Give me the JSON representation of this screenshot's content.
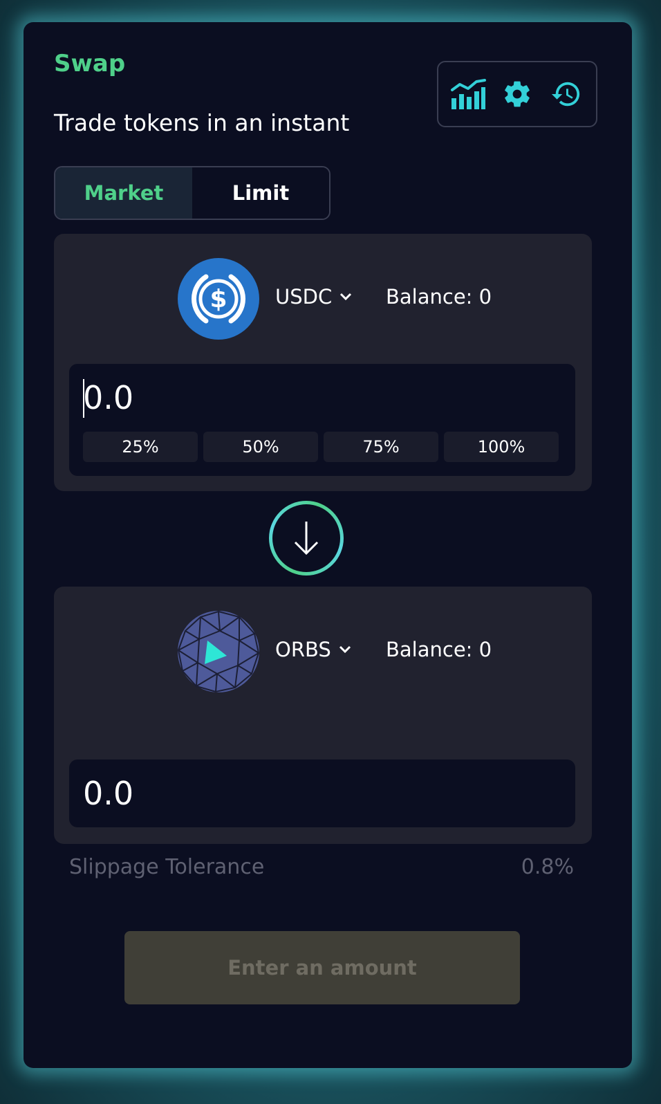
{
  "header": {
    "title": "Swap",
    "subtitle": "Trade tokens in an instant"
  },
  "toolbar": {
    "icons": [
      "chart-icon",
      "gear-icon",
      "history-icon"
    ],
    "accent_color": "#33d0d8"
  },
  "tabs": [
    {
      "label": "Market",
      "active": true
    },
    {
      "label": "Limit",
      "active": false
    }
  ],
  "from": {
    "token": "USDC",
    "balance": "Balance: 0",
    "amount_placeholder": "0.0",
    "percent_buttons": [
      "25%",
      "50%",
      "75%",
      "100%"
    ]
  },
  "to": {
    "token": "ORBS",
    "balance": "Balance: 0",
    "amount_placeholder": "0.0"
  },
  "slippage": {
    "label": "Slippage Tolerance",
    "value": "0.8%"
  },
  "cta": {
    "label": "Enter an amount"
  },
  "colors": {
    "brand_green": "#4fd08a",
    "card_bg": "#0b0e21",
    "panel_bg": "#21222f",
    "usdc_blue": "#2775ca",
    "orbs_purple": "#4e5a9a",
    "orbs_cyan": "#2ee6d6"
  }
}
